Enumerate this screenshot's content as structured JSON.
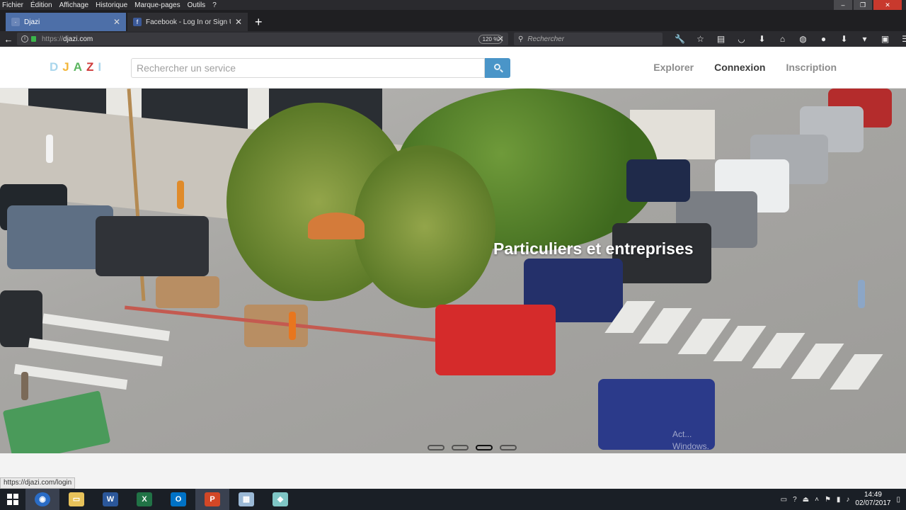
{
  "browser": {
    "menu": [
      "Fichier",
      "Édition",
      "Affichage",
      "Historique",
      "Marque-pages",
      "Outils",
      "?"
    ],
    "tabs": [
      {
        "title": "Djazi",
        "active": true
      },
      {
        "title": "Facebook - Log In or Sign U",
        "active": false
      }
    ],
    "url_scheme": "https://",
    "url_host": "djazi.com",
    "zoom": "120 %",
    "search_placeholder": "Rechercher"
  },
  "site": {
    "logo_letters": [
      "D",
      "J",
      "A",
      "Z",
      "I"
    ],
    "search_placeholder": "Rechercher un service",
    "nav": [
      {
        "label": "Explorer",
        "active": false
      },
      {
        "label": "Connexion",
        "active": true
      },
      {
        "label": "Inscription",
        "active": false
      }
    ],
    "hero_caption": "Particuliers et entreprises",
    "slides_count": 4,
    "active_slide": 3,
    "status_link": "https://djazi.com/login",
    "activate_watermark": [
      "Act...",
      "Windows."
    ]
  },
  "taskbar": {
    "time": "14:49",
    "date": "02/07/2017"
  },
  "colors": {
    "accent": "#4a95c8",
    "tab_active": "#4d6fa8"
  }
}
